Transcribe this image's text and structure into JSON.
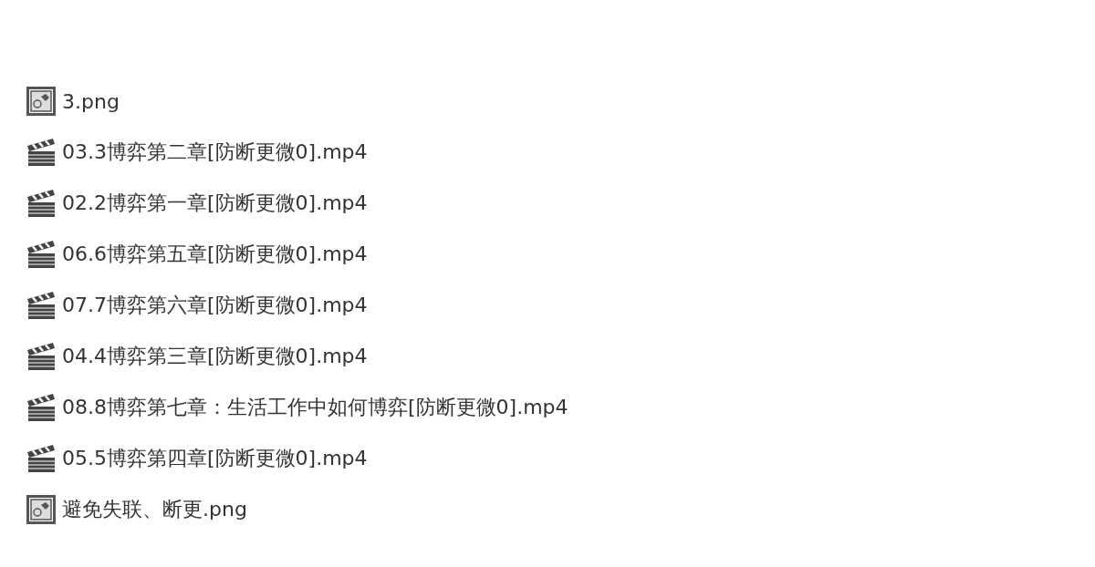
{
  "files": [
    {
      "kind": "image",
      "name": "3.png"
    },
    {
      "kind": "video",
      "name": "03.3博弈第二章[防断更微0].mp4"
    },
    {
      "kind": "video",
      "name": "02.2博弈第一章[防断更微0].mp4"
    },
    {
      "kind": "video",
      "name": "06.6博弈第五章[防断更微0].mp4"
    },
    {
      "kind": "video",
      "name": "07.7博弈第六章[防断更微0].mp4"
    },
    {
      "kind": "video",
      "name": "04.4博弈第三章[防断更微0].mp4"
    },
    {
      "kind": "video",
      "name": "08.8博弈第七章：生活工作中如何博弈[防断更微0].mp4"
    },
    {
      "kind": "video",
      "name": "05.5博弈第四章[防断更微0].mp4"
    },
    {
      "kind": "image",
      "name": "避免失联、断更.png"
    }
  ]
}
